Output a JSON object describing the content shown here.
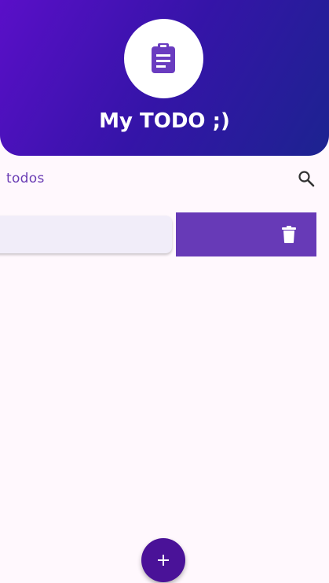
{
  "header": {
    "title": "My TODO ;)",
    "icon": "clipboard-icon",
    "gradient": [
      "#5a0fc8",
      "#3514a8",
      "#1c2390"
    ]
  },
  "list": {
    "section_label": "todos",
    "search_icon": "search-icon",
    "items": [
      {
        "text": "",
        "swipe_action_icon": "trash-icon"
      }
    ]
  },
  "fab": {
    "label": "+",
    "icon": "add-icon",
    "color": "#4a1298"
  },
  "colors": {
    "accent": "#673ab7",
    "background": "#fff8fd",
    "item_background": "#f1edf9"
  }
}
